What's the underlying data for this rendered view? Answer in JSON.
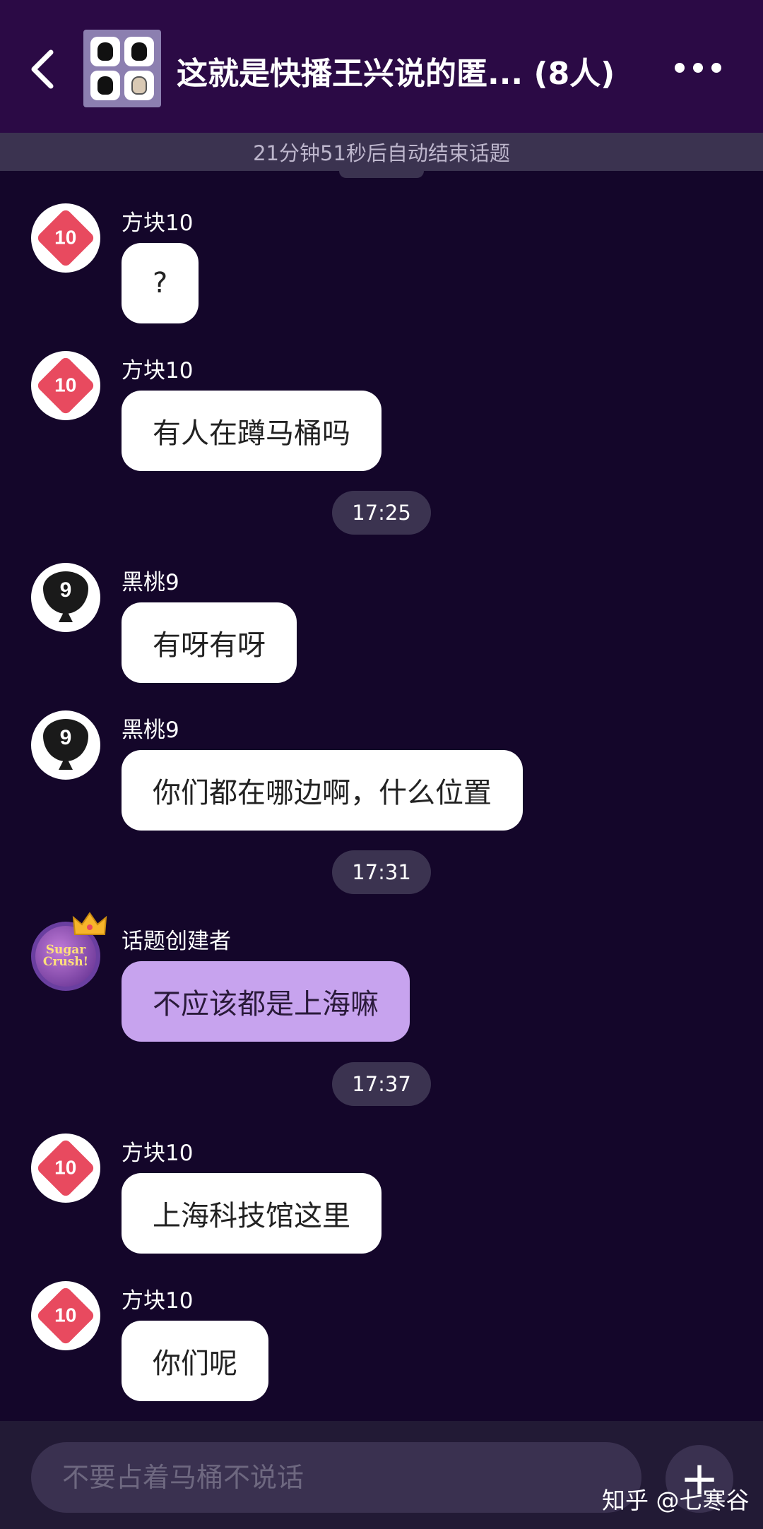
{
  "header": {
    "title": "这就是快播王兴说的匿... (8人)",
    "back_icon": "chevron-left-icon",
    "more_icon": "more-horizontal-icon"
  },
  "timer": {
    "text": "21分钟51秒后自动结束话题"
  },
  "messages": [
    {
      "sender": "方块10",
      "avatar": "diamond-10",
      "avatar_label": "10",
      "text": "?"
    },
    {
      "sender": "方块10",
      "avatar": "diamond-10",
      "avatar_label": "10",
      "text": "有人在蹲马桶吗"
    },
    {
      "sender": "黑桃9",
      "avatar": "spade-9",
      "avatar_label": "9",
      "text": "有呀有呀"
    },
    {
      "sender": "黑桃9",
      "avatar": "spade-9",
      "avatar_label": "9",
      "text": "你们都在哪边啊，什么位置"
    },
    {
      "sender": "话题创建者",
      "avatar": "candy-crush",
      "avatar_label": "Sugar Crush!",
      "text": "不应该都是上海嘛"
    },
    {
      "sender": "方块10",
      "avatar": "diamond-10",
      "avatar_label": "10",
      "text": "上海科技馆这里"
    },
    {
      "sender": "方块10",
      "avatar": "diamond-10",
      "avatar_label": "10",
      "text": "你们呢"
    }
  ],
  "times": [
    "17:25",
    "17:31",
    "17:37"
  ],
  "input": {
    "placeholder": "不要占着马桶不说话",
    "plus_label": "+"
  },
  "watermark": "知乎 @七寒谷",
  "colors": {
    "background": "#14062a",
    "header": "#2b0a45",
    "bubble": "#ffffff",
    "creator_bubble": "#c7a3ee",
    "diamond": "#e84a5f"
  }
}
